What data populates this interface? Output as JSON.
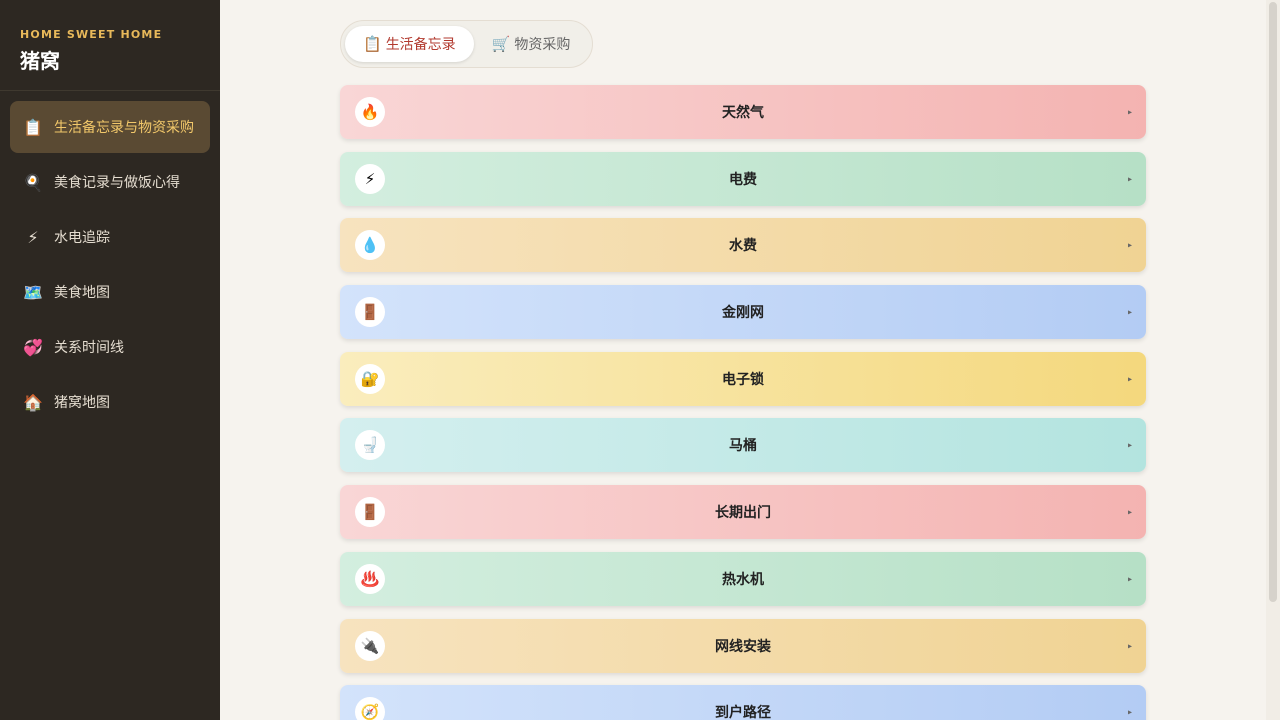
{
  "sidebar": {
    "brand_sub": "HOME SWEET HOME",
    "brand_title": "猪窝",
    "items": [
      {
        "icon": "📋",
        "label": "生活备忘录与物资采购",
        "active": true
      },
      {
        "icon": "🍳",
        "label": "美食记录与做饭心得",
        "active": false
      },
      {
        "icon": "⚡",
        "label": "水电追踪",
        "active": false
      },
      {
        "icon": "🗺️",
        "label": "美食地图",
        "active": false
      },
      {
        "icon": "💞",
        "label": "关系时间线",
        "active": false
      },
      {
        "icon": "🏠",
        "label": "猪窝地图",
        "active": false
      }
    ]
  },
  "tabs": [
    {
      "icon": "📋",
      "label": "生活备忘录",
      "active": true
    },
    {
      "icon": "🛒",
      "label": "物资采购",
      "active": false
    }
  ],
  "cards": [
    {
      "icon": "🔥",
      "title": "天然气",
      "color": "red"
    },
    {
      "icon": "⚡",
      "title": "电费",
      "color": "green"
    },
    {
      "icon": "💧",
      "title": "水费",
      "color": "orange"
    },
    {
      "icon": "🚪",
      "title": "金刚网",
      "color": "blue"
    },
    {
      "icon": "🔐",
      "title": "电子锁",
      "color": "yellow"
    },
    {
      "icon": "🚽",
      "title": "马桶",
      "color": "teal"
    },
    {
      "icon": "🚪",
      "title": "长期出门",
      "color": "red"
    },
    {
      "icon": "♨️",
      "title": "热水机",
      "color": "green"
    },
    {
      "icon": "🔌",
      "title": "网线安装",
      "color": "orange"
    },
    {
      "icon": "🧭",
      "title": "到户路径",
      "color": "blue"
    }
  ],
  "arrow": "▸",
  "colors": {
    "sidebar_bg": "#2d2822",
    "accent": "#f2c86a",
    "tab_active": "#b23a2f"
  }
}
